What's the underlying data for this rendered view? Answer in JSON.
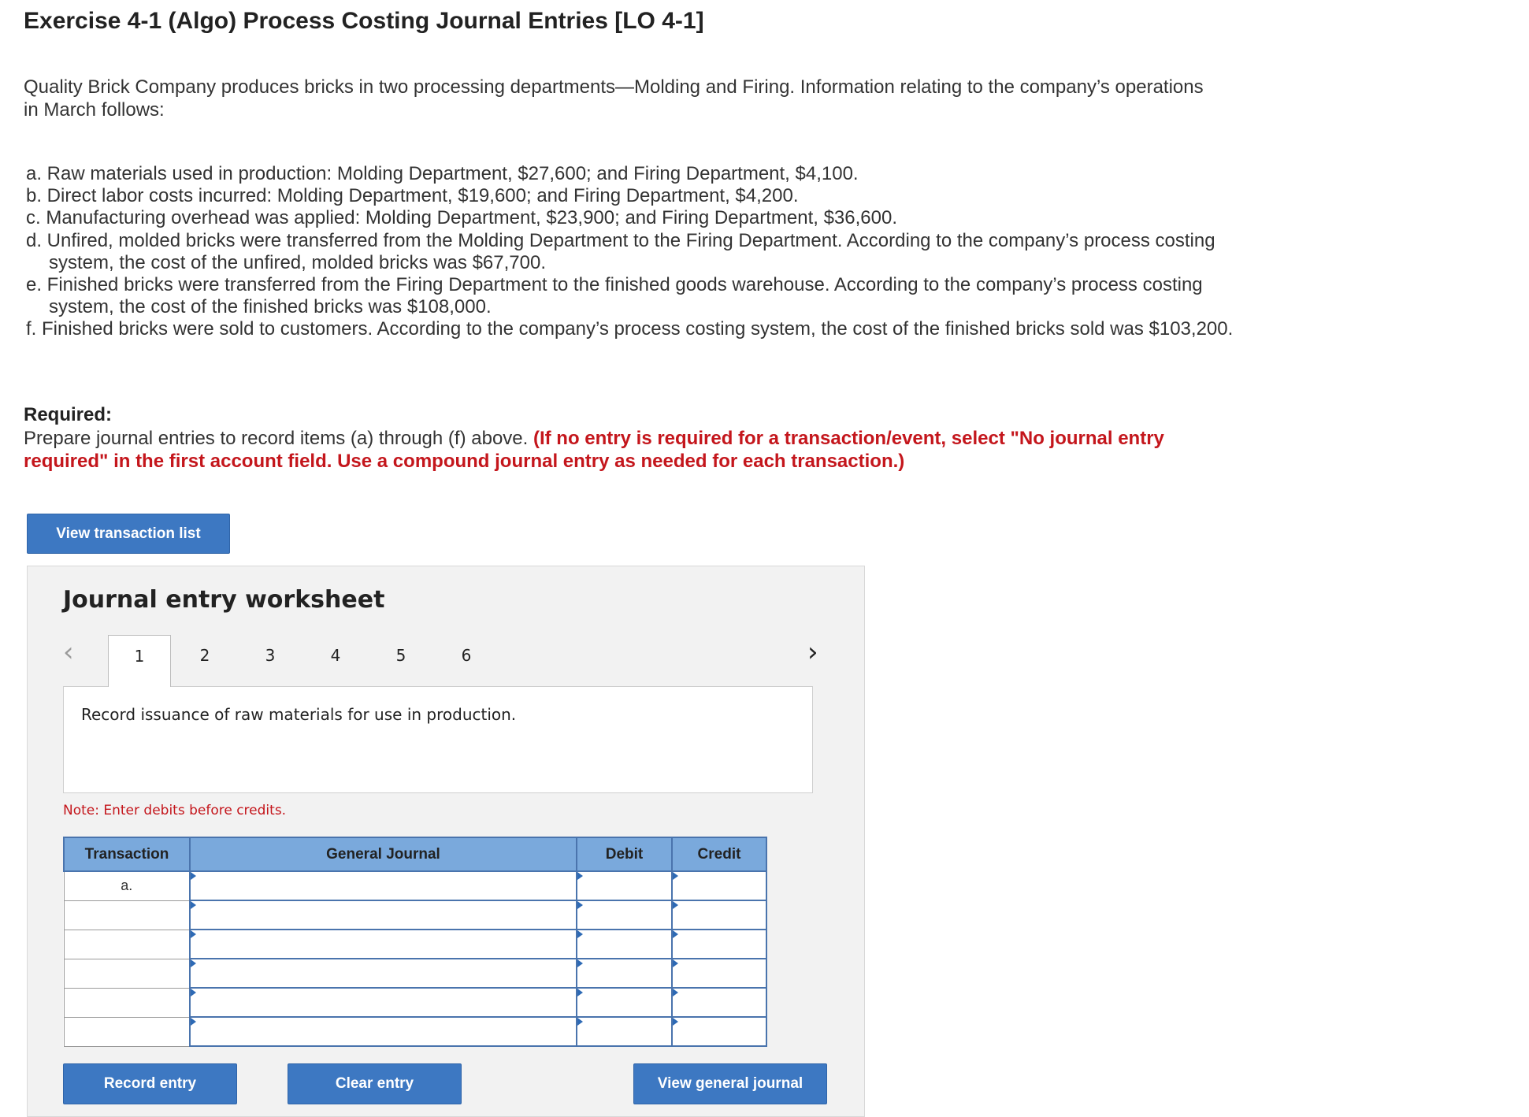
{
  "title": "Exercise 4-1 (Algo) Process Costing Journal Entries [LO 4-1]",
  "intro": "Quality Brick Company produces bricks in two processing departments—Molding and Firing. Information relating to the company’s operations in March follows:",
  "items": [
    "a. Raw materials used in production: Molding Department, $27,600; and Firing Department, $4,100.",
    "b. Direct labor costs incurred: Molding Department, $19,600; and Firing Department, $4,200.",
    "c. Manufacturing overhead was applied: Molding Department, $23,900; and Firing Department, $36,600.",
    "d. Unfired, molded bricks were transferred from the Molding Department to the Firing Department. According to the company’s process costing system, the cost of the unfired, molded bricks was $67,700.",
    "e. Finished bricks were transferred from the Firing Department to the finished goods warehouse. According to the company’s process costing system, the cost of the finished bricks was $108,000.",
    "f. Finished bricks were sold to customers. According to the company’s process costing system, the cost of the finished bricks sold was $103,200."
  ],
  "required": {
    "heading": "Required:",
    "text": "Prepare journal entries to record items (a) through (f) above.",
    "instruction": "(If no entry is required for a transaction/event, select \"No journal entry required\" in the first account field. Use a compound journal entry as needed for each transaction.)"
  },
  "view_transaction_list_label": "View transaction list",
  "worksheet": {
    "title": "Journal entry worksheet",
    "tabs": [
      "1",
      "2",
      "3",
      "4",
      "5",
      "6"
    ],
    "active_tab": "1",
    "description": "Record issuance of raw materials for use in production.",
    "note": "Note: Enter debits before credits.",
    "columns": {
      "transaction": "Transaction",
      "general_journal": "General Journal",
      "debit": "Debit",
      "credit": "Credit"
    },
    "rows": [
      {
        "transaction": "a.",
        "account": "",
        "debit": "",
        "credit": ""
      },
      {
        "transaction": "",
        "account": "",
        "debit": "",
        "credit": ""
      },
      {
        "transaction": "",
        "account": "",
        "debit": "",
        "credit": ""
      },
      {
        "transaction": "",
        "account": "",
        "debit": "",
        "credit": ""
      },
      {
        "transaction": "",
        "account": "",
        "debit": "",
        "credit": ""
      },
      {
        "transaction": "",
        "account": "",
        "debit": "",
        "credit": ""
      }
    ],
    "buttons": {
      "record": "Record entry",
      "clear": "Clear entry",
      "view_general_journal": "View general journal"
    }
  },
  "colors": {
    "button_blue": "#3d78c2",
    "header_blue": "#7aa9dc",
    "instruction_red": "#c4161c"
  },
  "icons": {
    "prev": "chevron-left-icon",
    "next": "chevron-right-icon"
  }
}
